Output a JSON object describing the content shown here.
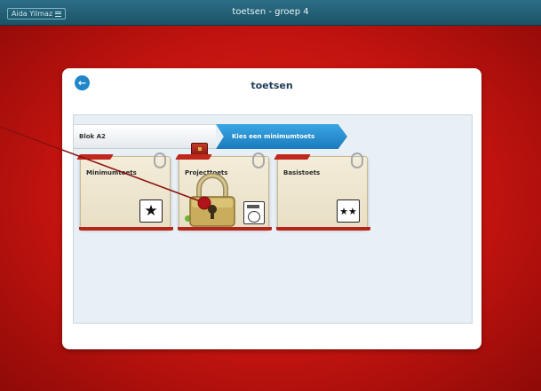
{
  "topbar": {
    "user": "Aida Yilmaz",
    "title": "toetsen - groep 4"
  },
  "panel": {
    "title": "toetsen"
  },
  "breadcrumb": {
    "left": "Blok A2",
    "right": "Kies een minimumtoets"
  },
  "cards": [
    {
      "label": "Minimumtoets",
      "icon": "star-icon"
    },
    {
      "label": "Projecttoets",
      "icon": "calculator-icon",
      "locked": true,
      "status": "completed"
    },
    {
      "label": "Basistoets",
      "icon": "two-stars-icon"
    }
  ],
  "colors": {
    "accent": "#1f86c9",
    "background": "#c4140f",
    "topbar": "#1c5266"
  }
}
